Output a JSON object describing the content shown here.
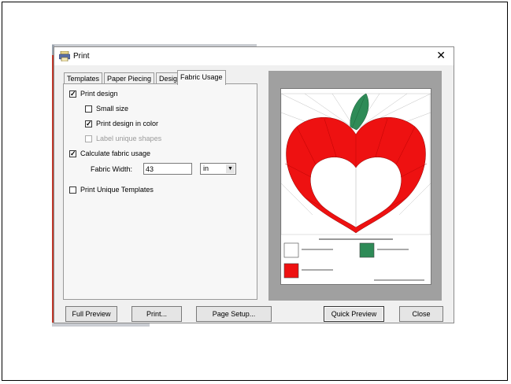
{
  "dialog": {
    "title": "Print",
    "close_glyph": "✕",
    "app_icon": "printer-icon"
  },
  "tabs": [
    {
      "label": "Templates",
      "active": false
    },
    {
      "label": "Paper Piecing",
      "active": false
    },
    {
      "label": "Design",
      "active": false
    },
    {
      "label": "Fabric Usage",
      "active": true
    }
  ],
  "fabric_usage": {
    "print_design": {
      "label": "Print design",
      "checked": true
    },
    "small_size": {
      "label": "Small size",
      "checked": false
    },
    "print_in_color": {
      "label": "Print design in color",
      "checked": true
    },
    "label_unique_shapes": {
      "label": "Label unique shapes",
      "checked": false,
      "disabled": true
    },
    "calculate_fabric_usage": {
      "label": "Calculate fabric usage",
      "checked": true
    },
    "fabric_width_label": "Fabric Width:",
    "fabric_width_value": "43",
    "fabric_width_unit": "in",
    "print_unique_templates": {
      "label": "Print Unique Templates",
      "checked": false
    }
  },
  "buttons": {
    "full_preview": "Full Preview",
    "print": "Print...",
    "page_setup": "Page Setup...",
    "quick_preview": "Quick Preview",
    "close": "Close"
  },
  "preview": {
    "colors": {
      "heart": "#ee1111",
      "leaf": "#2e8b57",
      "background": "#ffffff"
    }
  },
  "check_glyph": "✓"
}
